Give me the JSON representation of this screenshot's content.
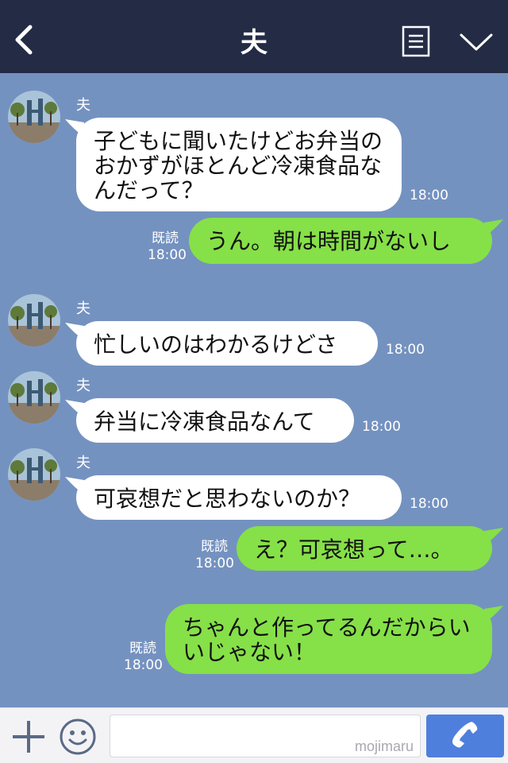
{
  "header": {
    "title": "夫"
  },
  "sender_name": "夫",
  "messages": [
    {
      "dir": "in",
      "text": "子どもに聞いたけどお弁当のおかずがほとんど冷凍食品なんだって？",
      "time": "18:00"
    },
    {
      "dir": "out",
      "text": "うん。朝は時間がないし",
      "read": "既読",
      "time": "18:00"
    },
    {
      "dir": "in",
      "text": "忙しいのはわかるけどさ",
      "time": "18:00"
    },
    {
      "dir": "in",
      "text": "弁当に冷凍食品なんて",
      "time": "18:00"
    },
    {
      "dir": "in",
      "text": "可哀想だと思わないのか？",
      "time": "18:00"
    },
    {
      "dir": "out",
      "text": "え？可哀想って…。",
      "read": "既読",
      "time": "18:00"
    },
    {
      "dir": "out",
      "text": "ちゃんと作ってるんだからいいじゃない！",
      "read": "既読",
      "time": "18:00"
    }
  ],
  "footer": {
    "input_value": "",
    "watermark": "mojimaru"
  },
  "colors": {
    "header": "#232b45",
    "background": "#7492c0",
    "incoming": "#ffffff",
    "outgoing": "#86e048",
    "send": "#4f7fdd"
  },
  "icons": [
    "back-icon",
    "notes-icon",
    "chevron-down-icon",
    "plus-icon",
    "emoji-icon",
    "phone-icon"
  ]
}
